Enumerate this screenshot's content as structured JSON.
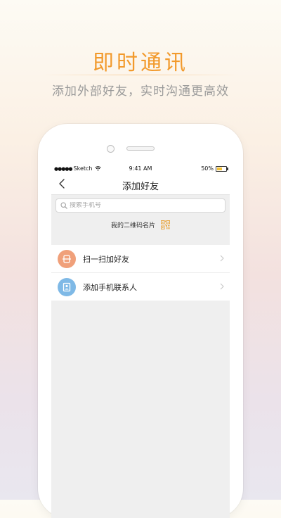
{
  "promo": {
    "title": "即时通讯",
    "subtitle": "添加外部好友，实时沟通更高效"
  },
  "status_bar": {
    "carrier": "Sketch",
    "time": "9:41 AM",
    "battery": "50%",
    "battery_level": 0.5
  },
  "nav": {
    "title": "添加好友",
    "back_icon": "chevron-left-icon"
  },
  "search": {
    "placeholder": "搜索手机号",
    "value": ""
  },
  "qr_card": {
    "label": "我的二维码名片",
    "icon": "qr-code-icon"
  },
  "options": [
    {
      "label": "扫一扫加好友",
      "icon": "scan-icon",
      "color": "#f0a07a"
    },
    {
      "label": "添加手机联系人",
      "icon": "contacts-icon",
      "color": "#7fb9e6"
    }
  ],
  "colors": {
    "accent": "#f29a2c"
  }
}
